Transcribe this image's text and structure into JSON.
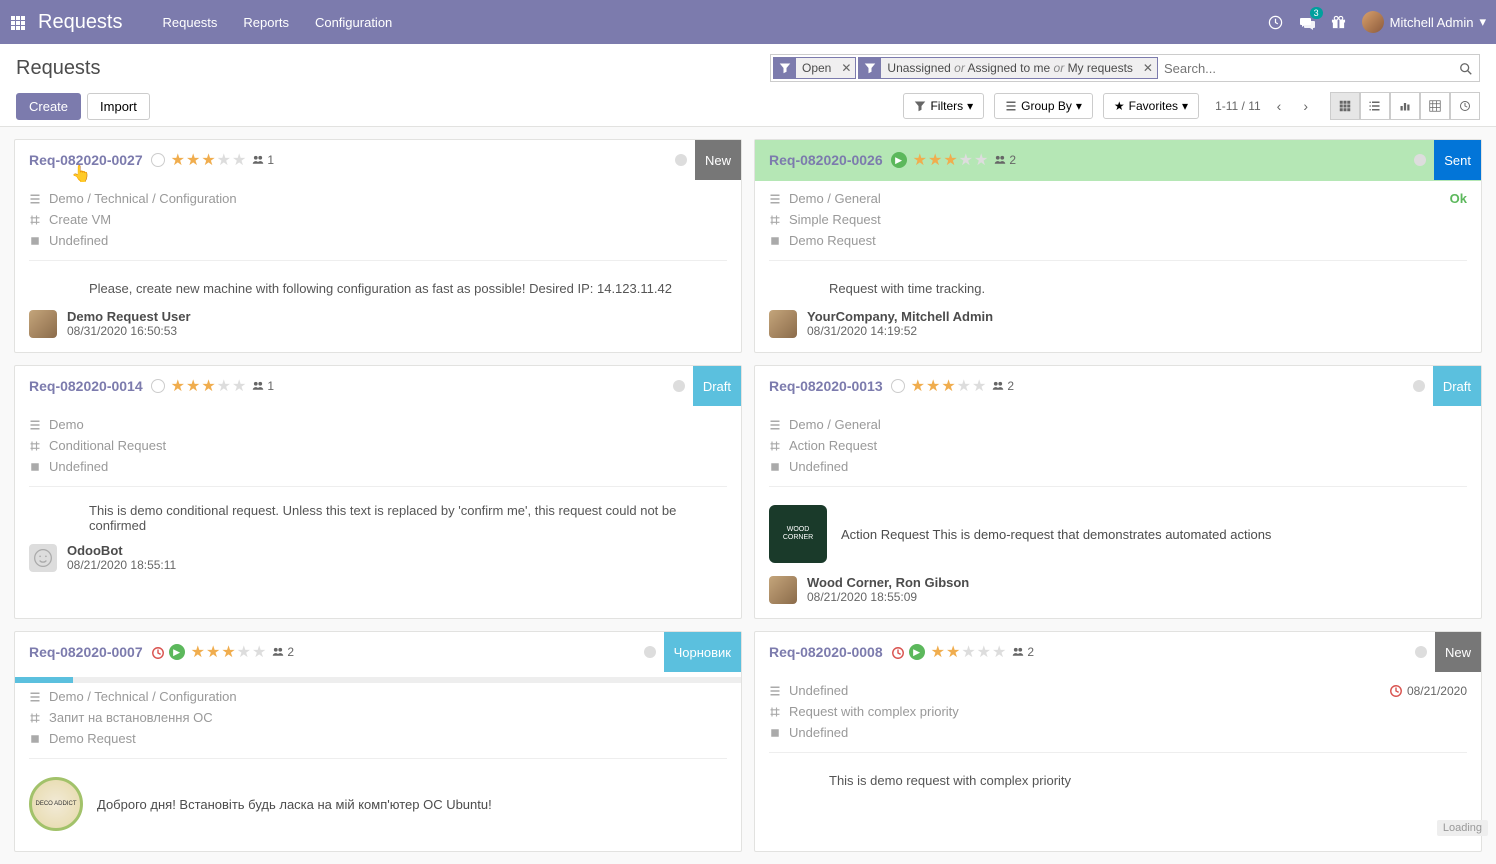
{
  "nav": {
    "brand": "Requests",
    "links": [
      "Requests",
      "Reports",
      "Configuration"
    ],
    "chat_count": "3",
    "user_name": "Mitchell Admin"
  },
  "header": {
    "title": "Requests",
    "filter1": "Open",
    "filter2_a": "Unassigned",
    "filter2_or1": "or",
    "filter2_b": "Assigned to me",
    "filter2_or2": "or",
    "filter2_c": "My requests",
    "search_placeholder": "Search...",
    "create": "Create",
    "import": "Import",
    "filters": "Filters",
    "groupby": "Group By",
    "favorites": "Favorites",
    "pager": "1-11 / 11"
  },
  "cards": [
    {
      "id": "Req-082020-0027",
      "badge": "New",
      "badge_class": "badge-new",
      "stars_on": 3,
      "follow_count": "1",
      "category": "Demo / Technical / Configuration",
      "type": "Create VM",
      "kind": "Undefined",
      "desc": "Please, create new machine with following configuration as fast as possible! Desired IP: 14.123.11.42",
      "author": "Demo Request User",
      "date": "08/31/2020 16:50:53"
    },
    {
      "id": "Req-082020-0026",
      "badge": "Sent",
      "badge_class": "badge-sent",
      "header_green": true,
      "play": true,
      "stars_on": 3,
      "follow_count": "2",
      "category": "Demo / General",
      "type": "Simple Request",
      "kind": "Demo Request",
      "ok": "Ok",
      "desc": "Request with time tracking.",
      "author": "YourCompany, Mitchell Admin",
      "date": "08/31/2020 14:19:52"
    },
    {
      "id": "Req-082020-0014",
      "badge": "Draft",
      "badge_class": "badge-draft",
      "stars_on": 3,
      "follow_count": "1",
      "category": "Demo",
      "type": "Conditional Request",
      "kind": "Undefined",
      "desc": "This is demo conditional request. Unless this text is replaced by 'confirm me', this request could not be confirmed",
      "author": "OdooBot",
      "date": "08/21/2020 18:55:11"
    },
    {
      "id": "Req-082020-0013",
      "badge": "Draft",
      "badge_class": "badge-draft",
      "stars_on": 3,
      "follow_count": "2",
      "category": "Demo / General",
      "type": "Action Request",
      "kind": "Undefined",
      "desc": "Action Request This is demo-request that demonstrates automated actions",
      "author": "Wood Corner, Ron Gibson",
      "date": "08/21/2020 18:55:09",
      "wood": true
    },
    {
      "id": "Req-082020-0007",
      "badge": "Чорновик",
      "badge_class": "badge-chorn",
      "clock": true,
      "play": true,
      "stars_on": 3,
      "follow_count": "2",
      "category": "Demo / Technical / Configuration",
      "type": "Запит на встановлення ОС",
      "kind": "Demo Request",
      "progress": true,
      "desc": "Доброго дня! Встановіть будь ласка на мій комп'ютер ОС Ubuntu!",
      "deco": true
    },
    {
      "id": "Req-082020-0008",
      "badge": "New",
      "badge_class": "badge-new",
      "clock": true,
      "play": true,
      "stars_on": 2,
      "follow_count": "2",
      "category": "Undefined",
      "type": "Request with complex priority",
      "kind": "Undefined",
      "deadline": "08/21/2020",
      "desc": "This is demo request with complex priority"
    }
  ],
  "loading": "Loading"
}
